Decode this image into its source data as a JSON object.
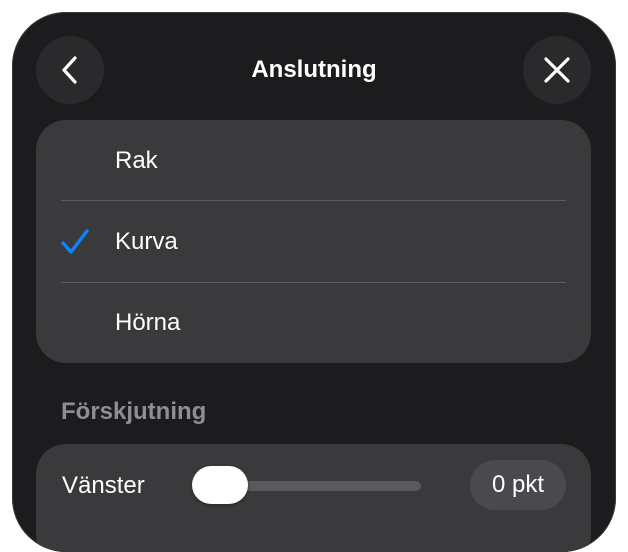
{
  "header": {
    "title": "Anslutning",
    "back_icon": "chevron-left-icon",
    "close_icon": "close-icon"
  },
  "connection_options": {
    "items": [
      {
        "label": "Rak",
        "selected": false
      },
      {
        "label": "Kurva",
        "selected": true
      },
      {
        "label": "Hörna",
        "selected": false
      }
    ],
    "check_icon": "checkmark-icon"
  },
  "offset": {
    "section_label": "Förskjutning",
    "left": {
      "label": "Vänster",
      "value_text": "0 pkt",
      "slider_fraction": 0
    }
  },
  "colors": {
    "background": "#1c1c1e",
    "card": "#3a3a3c",
    "accent": "#0a84ff",
    "secondary_text": "#8e8e93"
  }
}
